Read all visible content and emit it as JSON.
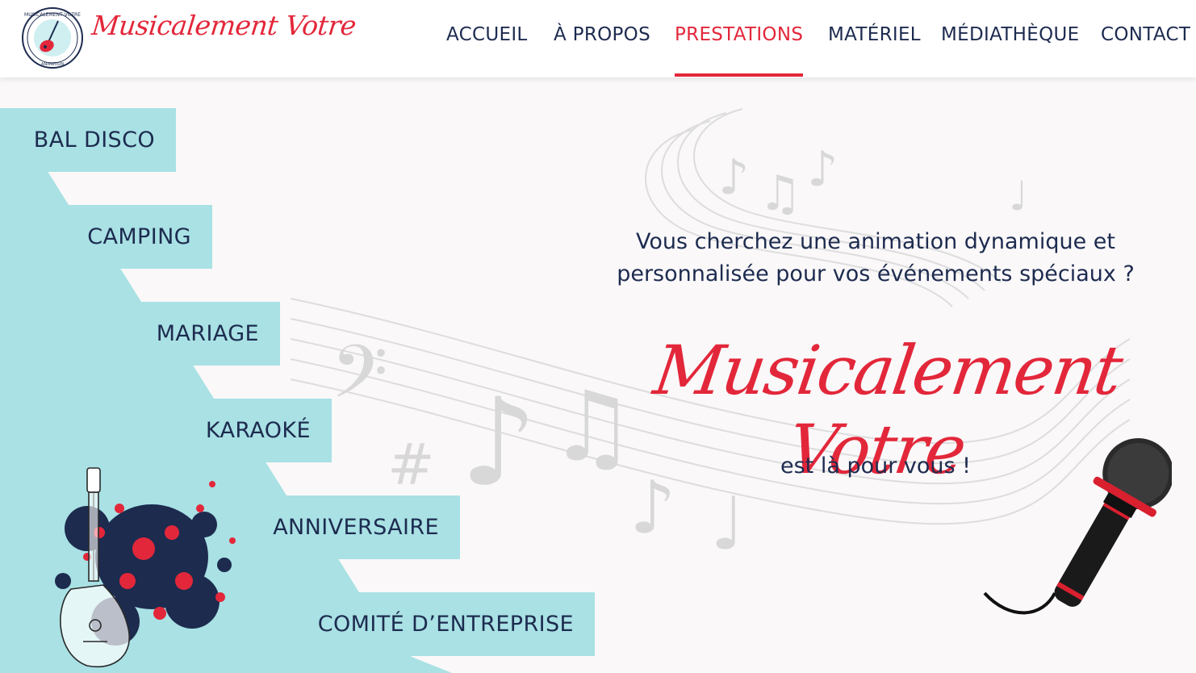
{
  "header": {
    "logo_text": "Musicalement Votre",
    "nav": [
      {
        "label": "ACCUEIL",
        "active": false
      },
      {
        "label": "À PROPOS",
        "active": false
      },
      {
        "label": "PRESTATIONS",
        "active": true
      },
      {
        "label": "MATÉRIEL",
        "active": false
      },
      {
        "label": "MÉDIATHÈQUE",
        "active": false
      },
      {
        "label": "CONTACT",
        "active": false
      }
    ]
  },
  "services": [
    {
      "label": "BAL DISCO"
    },
    {
      "label": "CAMPING"
    },
    {
      "label": "MARIAGE"
    },
    {
      "label": "KARAOKÉ"
    },
    {
      "label": "ANNIVERSAIRE"
    },
    {
      "label": "COMITÉ D’ENTREPRISE"
    }
  ],
  "hero": {
    "tagline": "Vous cherchez une animation dynamique et personnalisée pour vos événements spéciaux ?",
    "brand": "Musicalement Votre",
    "subtag": "est là pour vous !"
  },
  "colors": {
    "accent": "#e3273a",
    "navy": "#1d2b4f",
    "teal": "#a9e1e4"
  },
  "icons": {
    "logo": "guitar-badge-icon",
    "guitar": "guitar-splash-icon",
    "microphone": "microphone-icon"
  }
}
